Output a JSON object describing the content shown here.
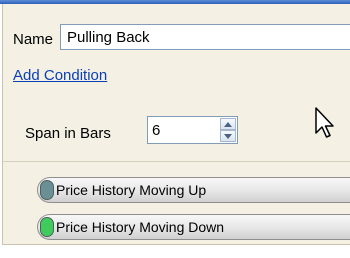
{
  "form": {
    "name_label": "Name",
    "name_value": "Pulling Back",
    "add_condition_label": "Add Condition",
    "span_label": "Span in Bars",
    "span_value": "6"
  },
  "conditions": [
    {
      "label": "Price History Moving Up",
      "indicator_color": "#6a8f95"
    },
    {
      "label": "Price History Moving Down",
      "indicator_color": "#3fcc5c"
    }
  ],
  "icons": {
    "pointer": "mouse-pointer-icon",
    "spin_up": "spin-up-arrow-icon",
    "spin_down": "spin-down-arrow-icon"
  },
  "colors": {
    "panel_background": "#f4f1e4",
    "link": "#0a3fb5",
    "title_bar": "#2e5fb8"
  }
}
